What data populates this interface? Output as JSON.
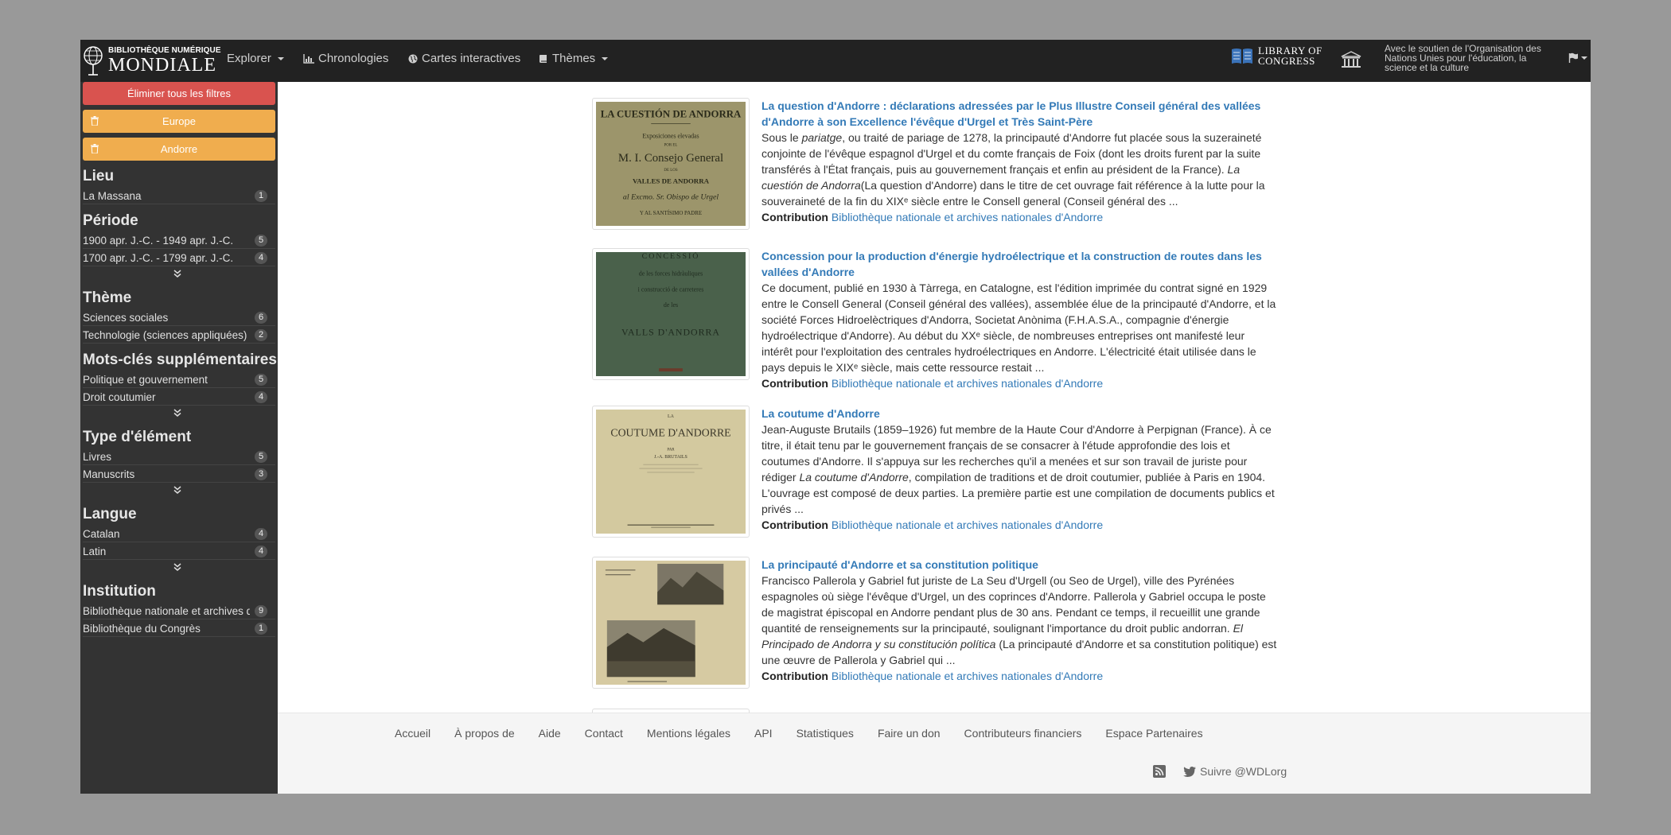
{
  "brand": {
    "line1": "BIBLIOTHÈQUE NUMÉRIQUE",
    "line2": "MONDIALE"
  },
  "nav": [
    {
      "label": "Explorer",
      "icon": "none",
      "dropdown": true
    },
    {
      "label": "Chronologies",
      "icon": "bar-chart-icon",
      "dropdown": false
    },
    {
      "label": "Cartes interactives",
      "icon": "globe-icon",
      "dropdown": false
    },
    {
      "label": "Thèmes",
      "icon": "book-icon",
      "dropdown": true
    }
  ],
  "partners": {
    "loc_line1": "LIBRARY OF",
    "loc_line2": "CONGRESS",
    "unesco_text": "Avec le soutien de l'Organisation des Nations Unies pour l'éducation, la science et la culture"
  },
  "filters": {
    "clear_all": "Éliminer tous les filtres",
    "active": [
      "Europe",
      "Andorre"
    ]
  },
  "facets": [
    {
      "title": "Lieu",
      "items": [
        {
          "label": "La Massana",
          "count": "1"
        }
      ]
    },
    {
      "title": "Période",
      "items": [
        {
          "label": "1900 apr. J.-C. - 1949 apr. J.-C.",
          "count": "5"
        },
        {
          "label": "1700 apr. J.-C. - 1799 apr. J.-C.",
          "count": "4"
        }
      ]
    },
    {
      "title": "Thème",
      "items": [
        {
          "label": "Sciences sociales",
          "count": "6"
        },
        {
          "label": "Technologie (sciences appliquées)",
          "count": "2"
        }
      ]
    },
    {
      "title": "Mots-clés supplémentaires",
      "items": [
        {
          "label": "Politique et gouvernement",
          "count": "5"
        },
        {
          "label": "Droit coutumier",
          "count": "4"
        }
      ]
    },
    {
      "title": "Type d'élément",
      "items": [
        {
          "label": "Livres",
          "count": "5"
        },
        {
          "label": "Manuscrits",
          "count": "3"
        }
      ]
    },
    {
      "title": "Langue",
      "items": [
        {
          "label": "Catalan",
          "count": "4"
        },
        {
          "label": "Latin",
          "count": "4"
        }
      ]
    },
    {
      "title": "Institution",
      "items": [
        {
          "label": "Bibliothèque nationale et archives d'Andorre",
          "count": "9"
        },
        {
          "label": "Bibliothèque du Congrès",
          "count": "1"
        }
      ]
    }
  ],
  "results": [
    {
      "title": "La question d'Andorre : déclarations adressées par le Plus Illustre Conseil général des vallées d'Andorre à son Excellence l'évêque d'Urgel et Très Saint-Père",
      "desc": [
        "Sous le ",
        {
          "i": "pariatge"
        },
        ", ou traité de pariage de 1278, la principauté d'Andorre fut placée sous la suzeraineté conjointe de l'évêque espagnol d'Urgel et du comte français de Foix (dont les droits furent par la suite transférés à l'État français, puis au gouvernement français et enfin au président de la France). ",
        {
          "i": "La cuestión de Andorra"
        },
        "(La question d'Andorre) dans le titre de cet ouvrage fait référence à la lutte pour la souveraineté de la fin du XIXᵉ siècle entre le Consell general (Conseil général des ..."
      ],
      "contrib_label": "Contribution",
      "contrib": "Bibliothèque nationale et archives nationales d'Andorre",
      "thumb_text": [
        "LA CUESTIÓN DE ANDORRA",
        "Exposiciones elevadas",
        "POR EL",
        "M. I. Consejo General",
        "DE LOS",
        "VALLES DE ANDORRA",
        "al Excmo. Sr. Obispo de Urgel",
        "Y AL SANTÍSIMO PADRE"
      ]
    },
    {
      "title": "Concession pour la production d'énergie hydroélectrique et la construction de routes dans les vallées d'Andorre",
      "desc": [
        "Ce document, publié en 1930 à Tàrrega, en Catalogne, est l'édition imprimée du contrat signé en 1929 entre le Consell General (Conseil général des vallées), assemblée élue de la principauté d'Andorre, et la société Forces Hidroelèctriques d'Andorra, Societat Anònima (F.H.A.S.A., compagnie d'énergie hydroélectrique d'Andorre). Au début du XXᵉ siècle, de nombreuses entreprises ont manifesté leur intérêt pour l'exploitation des centrales hydroélectriques en Andorre. L'électricité était utilisée dans le pays depuis le XIXᵉ siècle, mais cette ressource restait ..."
      ],
      "contrib_label": "Contribution",
      "contrib": "Bibliothèque nationale et archives nationales d'Andorre",
      "thumb_text": [
        "CONCESSIÓ",
        "de les forces hidràuliques",
        "i construcció de carreteres",
        "de les",
        "VALLS D'ANDORRA"
      ]
    },
    {
      "title": "La coutume d'Andorre",
      "desc": [
        "Jean-Auguste Brutails (1859–1926) fut membre de la Haute Cour d'Andorre à Perpignan (France). À ce titre, il était tenu par le gouvernement français de se consacrer à l'étude approfondie des lois et coutumes d'Andorre. Il s'appuya sur les recherches qu'il a menées et sur son travail de juriste pour rédiger ",
        {
          "i": "La coutume d'Andorre"
        },
        ", compilation de traditions et de droit coutumier, publiée à Paris en 1904. L'ouvrage est composé de deux parties. La première partie est une compilation de documents publics et privés ..."
      ],
      "contrib_label": "Contribution",
      "contrib": "Bibliothèque nationale et archives nationales d'Andorre",
      "thumb_text": [
        "LA",
        "COUTUME D'ANDORRE",
        "PAR",
        "J.-A. BRUTAILS"
      ]
    },
    {
      "title": "La principauté d'Andorre et sa constitution politique",
      "desc": [
        "Francisco Pallerola y Gabriel fut juriste de La Seu d'Urgell (ou Seo de Urgel), ville des Pyrénées espagnoles où siège l'évêque d'Urgel, un des coprinces d'Andorre. Pallerola y Gabriel occupa le poste de magistrat épiscopal en Andorre pendant plus de 30 ans. Pendant ce temps, il recueillit une grande quantité de renseignements sur la principauté, soulignant l'importance du droit public andorran. ",
        {
          "i": "El Principado de Andorra y su constitución política"
        },
        " (La principauté d'Andorre et sa constitution politique) est une œuvre de Pallerola y Gabriel qui ..."
      ],
      "contrib_label": "Contribution",
      "contrib": "Bibliothèque nationale et archives nationales d'Andorre",
      "thumb_text": []
    }
  ],
  "footer": {
    "links": [
      "Accueil",
      "À propos de",
      "Aide",
      "Contact",
      "Mentions légales",
      "API",
      "Statistiques",
      "Faire un don",
      "Contributeurs financiers",
      "Espace Partenaires"
    ],
    "twitter": "Suivre @WDLorg"
  },
  "colors": {
    "navbar": "#222222",
    "sidebar": "#333333",
    "danger": "#d9534f",
    "warning": "#f0ad4e",
    "link": "#337ab7"
  }
}
